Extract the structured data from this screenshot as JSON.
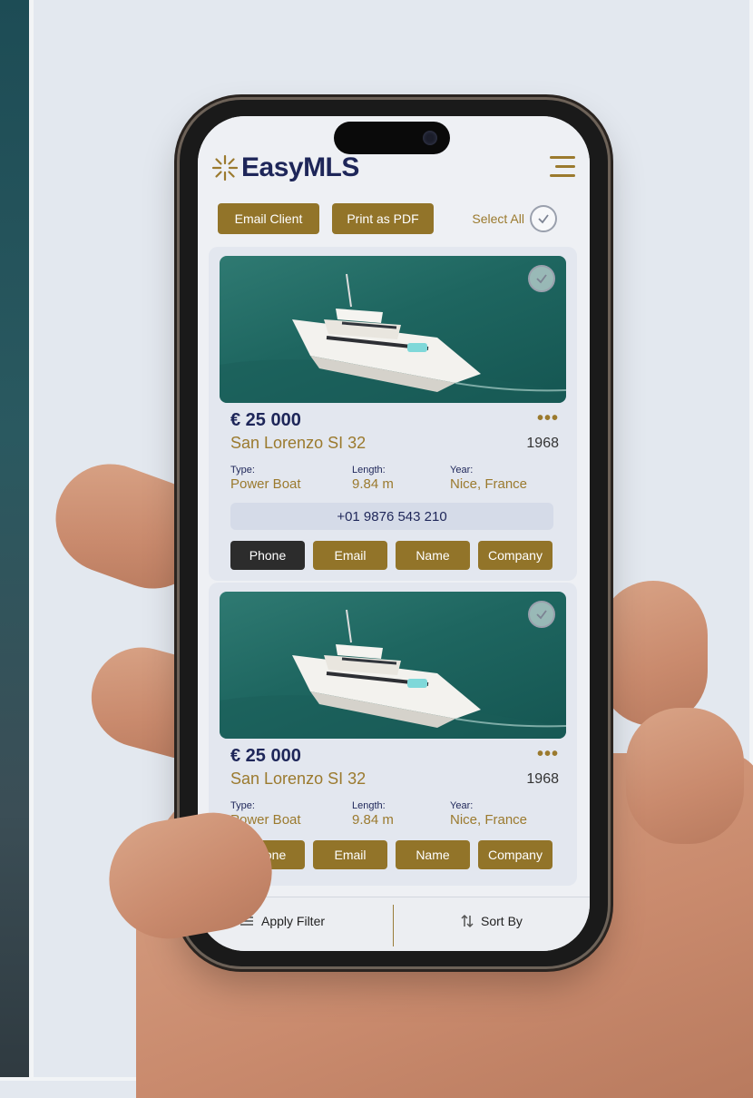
{
  "app": {
    "logo_text": "EasyMLS"
  },
  "toolbar": {
    "email_client": "Email Client",
    "print_pdf": "Print as PDF",
    "select_all": "Select All"
  },
  "colors": {
    "navy": "#1e2659",
    "gold": "#927429",
    "dark_button": "#2c2c2c",
    "screen_bg": "#eef0f4"
  },
  "listings": [
    {
      "price": "€ 25 000",
      "name": "San Lorenzo SI 32",
      "year": "1968",
      "type_label": "Type:",
      "type_value": "Power Boat",
      "length_label": "Length:",
      "length_value": "9.84 m",
      "location_label": "Year:",
      "location_value": "Nice, France",
      "phone_number": "+01 9876 543 210",
      "actions": [
        "Phone",
        "Email",
        "Name",
        "Company"
      ]
    },
    {
      "price": "€ 25 000",
      "name": "San Lorenzo SI 32",
      "year": "1968",
      "type_label": "Type:",
      "type_value": "Power Boat",
      "length_label": "Length:",
      "length_value": "9.84 m",
      "location_label": "Year:",
      "location_value": "Nice, France",
      "actions": [
        "Phone",
        "Email",
        "Name",
        "Company"
      ]
    }
  ],
  "bottom": {
    "apply_filter": "Apply Filter",
    "sort_by": "Sort By"
  },
  "icons": {
    "menu": "hamburger-icon",
    "check": "check-circle-icon",
    "more": "more-dots-icon",
    "filter": "filter-icon",
    "sort": "sort-icon"
  }
}
